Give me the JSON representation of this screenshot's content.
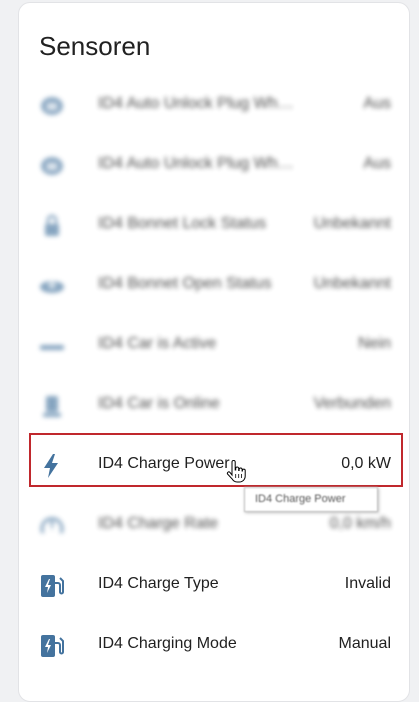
{
  "card": {
    "title": "Sensoren"
  },
  "colors": {
    "icon": "#44739e",
    "highlight": "#c0282d",
    "text": "#212121"
  },
  "rows": [
    {
      "name": "ID4 Auto Unlock Plug When Ch...",
      "value": "Aus",
      "icon": "sync-lock-icon",
      "blurred": true
    },
    {
      "name": "ID4 Auto Unlock Plug When Ch...",
      "value": "Aus",
      "icon": "sync-lock-icon",
      "blurred": true
    },
    {
      "name": "ID4 Bonnet Lock Status",
      "value": "Unbekannt",
      "icon": "car-lock-icon",
      "blurred": true
    },
    {
      "name": "ID4 Bonnet Open Status",
      "value": "Unbekannt",
      "icon": "car-door-icon",
      "blurred": true
    },
    {
      "name": "ID4 Car is Active",
      "value": "Nein",
      "icon": "car-icon",
      "blurred": true
    },
    {
      "name": "ID4 Car is Online",
      "value": "Verbunden",
      "icon": "car-connected-icon",
      "blurred": true
    },
    {
      "name": "ID4 Charge Power",
      "value": "0,0 kW",
      "icon": "flash-icon",
      "blurred": false
    },
    {
      "name": "ID4 Charge Rate",
      "value": "0,0 km/h",
      "icon": "speedometer-icon",
      "blurred": true
    },
    {
      "name": "ID4 Charge Type",
      "value": "Invalid",
      "icon": "ev-station-icon",
      "blurred": false
    },
    {
      "name": "ID4 Charging Mode",
      "value": "Manual",
      "icon": "ev-station-icon",
      "blurred": false
    }
  ],
  "tooltip": {
    "text": "ID4 Charge Power"
  }
}
